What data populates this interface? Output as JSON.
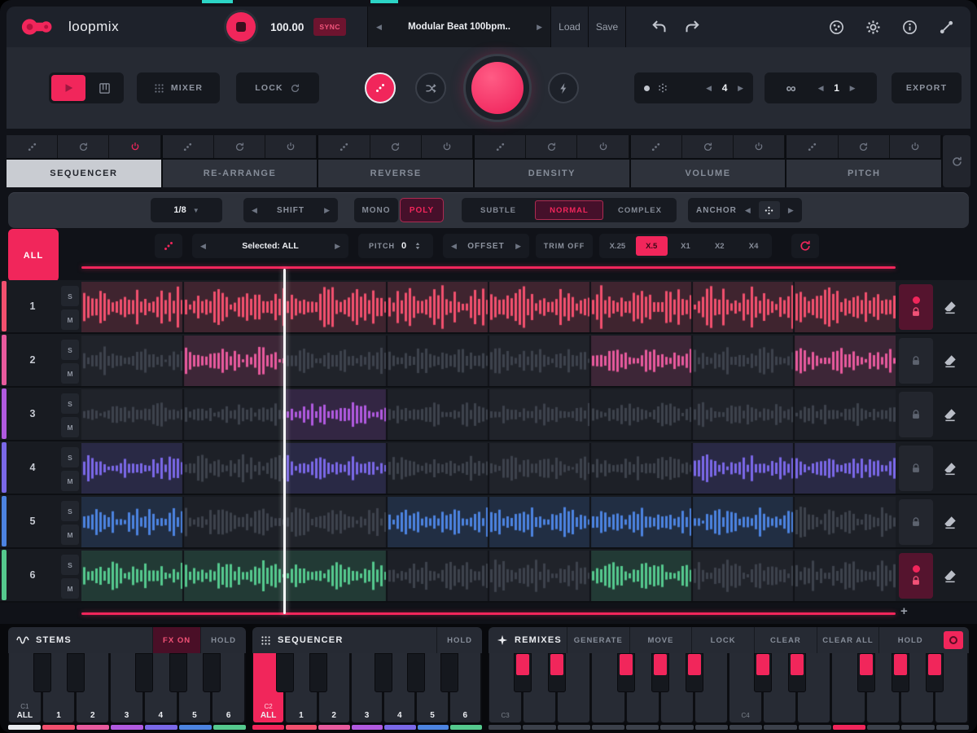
{
  "icons": {
    "infinity": "∞",
    "add": "+",
    "chevron_left": "◀",
    "chevron_right": "▶",
    "dropdown": "▼"
  },
  "topbar": {
    "logo": "loopmix",
    "bpm": "100.00",
    "sync": "SYNC",
    "preset": "Modular Beat 100bpm..",
    "load": "Load",
    "save": "Save"
  },
  "controls": {
    "mixer": "MIXER",
    "lock": "LOCK",
    "pattern_value": "4",
    "loop_value": "1",
    "export": "EXPORT"
  },
  "tabs": [
    {
      "label": "SEQUENCER",
      "active": true
    },
    {
      "label": "RE-ARRANGE",
      "active": false
    },
    {
      "label": "REVERSE",
      "active": false
    },
    {
      "label": "DENSITY",
      "active": false
    },
    {
      "label": "VOLUME",
      "active": false
    },
    {
      "label": "PITCH",
      "active": false
    }
  ],
  "toolbar": {
    "rate": "1/8",
    "shift": "SHIFT",
    "mono": "MONO",
    "poly": "POLY",
    "subtle": "SUBTLE",
    "normal": "NORMAL",
    "complex": "COMPLEX",
    "anchor": "ANCHOR"
  },
  "selection": {
    "all": "ALL",
    "selected": "Selected: ALL",
    "pitch_label": "PITCH",
    "pitch_value": "0",
    "offset": "OFFSET",
    "trim": "TRIM OFF",
    "speeds": [
      {
        "label": "X.25",
        "active": false
      },
      {
        "label": "X.5",
        "active": true
      },
      {
        "label": "X1",
        "active": false
      },
      {
        "label": "X2",
        "active": false
      },
      {
        "label": "X4",
        "active": false
      }
    ]
  },
  "tracks": [
    {
      "num": "1",
      "solo": "S",
      "mute": "M",
      "color": "#f2506e",
      "amp": 0.95,
      "seed": 3,
      "locked": true,
      "cells": [
        1,
        1,
        1,
        1,
        1,
        1,
        1,
        1
      ]
    },
    {
      "num": "2",
      "solo": "S",
      "mute": "M",
      "color": "#e85a9d",
      "amp": 0.62,
      "seed": 7,
      "locked": false,
      "cells": [
        0,
        1,
        0,
        0,
        0,
        1,
        0,
        1
      ]
    },
    {
      "num": "3",
      "solo": "S",
      "mute": "M",
      "color": "#b15ae0",
      "amp": 0.55,
      "seed": 11,
      "locked": false,
      "cells": [
        0,
        0,
        1,
        0,
        0,
        0,
        0,
        0
      ]
    },
    {
      "num": "4",
      "solo": "S",
      "mute": "M",
      "color": "#7a68e8",
      "amp": 0.6,
      "seed": 13,
      "locked": false,
      "cells": [
        1,
        0,
        1,
        0,
        0,
        0,
        1,
        1
      ]
    },
    {
      "num": "5",
      "solo": "S",
      "mute": "M",
      "color": "#4c83e0",
      "amp": 0.66,
      "seed": 17,
      "locked": false,
      "cells": [
        1,
        0,
        0,
        1,
        1,
        1,
        1,
        0
      ]
    },
    {
      "num": "6",
      "solo": "S",
      "mute": "M",
      "color": "#55c98e",
      "amp": 0.72,
      "seed": 19,
      "locked": true,
      "cells": [
        1,
        1,
        1,
        0,
        0,
        1,
        0,
        0
      ]
    }
  ],
  "panels": {
    "stems": {
      "title": "STEMS",
      "fx": "FX ON",
      "hold": "HOLD"
    },
    "sequencer": {
      "title": "SEQUENCER",
      "hold": "HOLD"
    },
    "remixes": {
      "title": "REMIXES",
      "buttons": [
        {
          "label": "GENERATE",
          "name": "generate"
        },
        {
          "label": "MOVE",
          "name": "move"
        },
        {
          "label": "LOCK",
          "name": "lock"
        },
        {
          "label": "CLEAR",
          "name": "clear"
        },
        {
          "label": "CLEAR ALL",
          "name": "clear-all"
        },
        {
          "label": "HOLD",
          "name": "hold"
        }
      ]
    }
  },
  "keyboard": {
    "zone1": {
      "octave": "C1",
      "labels": [
        "ALL",
        "1",
        "2",
        "3",
        "4",
        "5",
        "6"
      ],
      "strip_colors": [
        "#e9ebef",
        "#f2506e",
        "#e85a9d",
        "#b15ae0",
        "#7a68e8",
        "#4c83e0",
        "#55c98e"
      ],
      "pressed_index": -1
    },
    "zone2": {
      "octave": "C2",
      "labels": [
        "ALL",
        "1",
        "2",
        "3",
        "4",
        "5",
        "6"
      ],
      "strip_colors": [
        "#f1265b",
        "#f2506e",
        "#e85a9d",
        "#b15ae0",
        "#7a68e8",
        "#4c83e0",
        "#55c98e"
      ],
      "pressed_index": 0
    },
    "zone3": {
      "octaves": [
        {
          "white_index": 0,
          "label": "C3"
        },
        {
          "white_index": 7,
          "label": "C4"
        }
      ],
      "white_count": 14,
      "black_pink": true,
      "pink_strip_index": 10
    }
  },
  "colors": {
    "accent": "#f1265b",
    "teal": "#2cd5c6"
  }
}
